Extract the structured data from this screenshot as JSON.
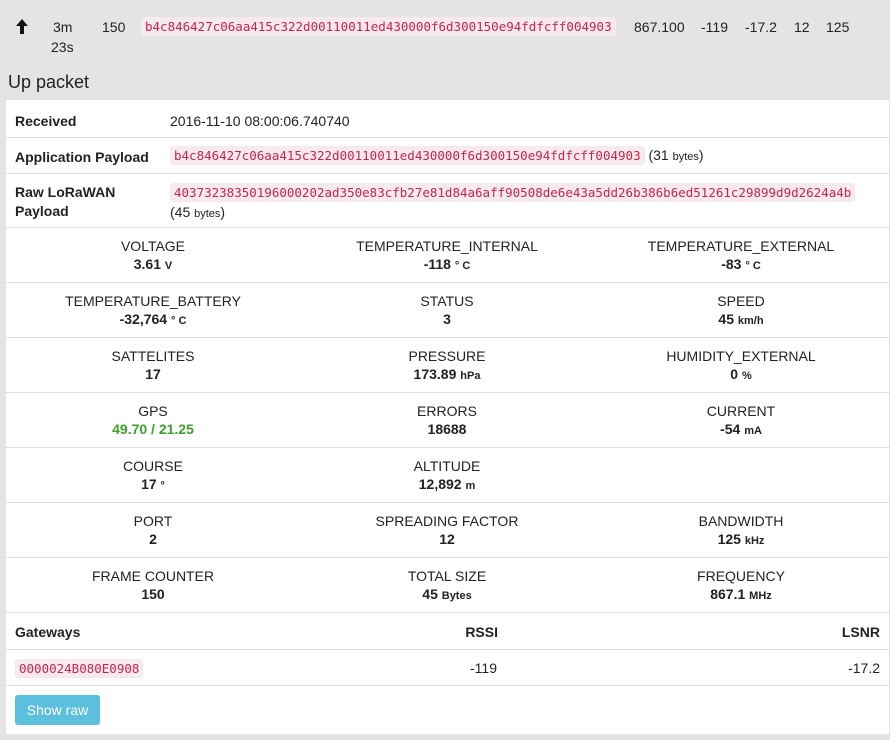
{
  "summary": {
    "time": "3m",
    "time2": "23s",
    "counter": "150",
    "payload": "b4c846427c06aa415c322d00110011ed430000f6d300150e94fdfcff004903",
    "frequency": "867.100",
    "rssi": "-119",
    "lsnr": "-17.2",
    "sf": "12",
    "bw": "125"
  },
  "section_title": "Up packet",
  "received": {
    "label": "Received",
    "value": "2016-11-10 08:00:06.740740"
  },
  "app_payload": {
    "label": "Application Payload",
    "value": "b4c846427c06aa415c322d00110011ed430000f6d300150e94fdfcff004903",
    "size_prefix": "(31 ",
    "size_unit": "bytes",
    "size_suffix": ")"
  },
  "raw_payload": {
    "label1": "Raw LoRaWAN",
    "label2": "Payload",
    "value": "40373238350196000202ad350e83cfb27e81d84a6aff90508de6e43a5dd26b386b6ed51261c29899d9d2624a4b",
    "size_prefix": "(45 ",
    "size_unit": "bytes",
    "size_suffix": ")"
  },
  "metrics": [
    [
      {
        "name": "VOLTAGE",
        "value": "3.61",
        "unit": "V"
      },
      {
        "name": "TEMPERATURE_INTERNAL",
        "value": "-118",
        "unit": "° C"
      },
      {
        "name": "TEMPERATURE_EXTERNAL",
        "value": "-83",
        "unit": "° C"
      }
    ],
    [
      {
        "name": "TEMPERATURE_BATTERY",
        "value": "-32,764",
        "unit": "° C"
      },
      {
        "name": "STATUS",
        "value": "3",
        "unit": ""
      },
      {
        "name": "SPEED",
        "value": "45",
        "unit": "km/h"
      }
    ],
    [
      {
        "name": "SATTELITES",
        "value": "17",
        "unit": ""
      },
      {
        "name": "PRESSURE",
        "value": "173.89",
        "unit": "hPa"
      },
      {
        "name": "HUMIDITY_EXTERNAL",
        "value": "0",
        "unit": "%"
      }
    ],
    [
      {
        "name": "GPS",
        "value": "49.70 / 21.25",
        "unit": ""
      },
      {
        "name": "ERRORS",
        "value": "18688",
        "unit": ""
      },
      {
        "name": "CURRENT",
        "value": "-54",
        "unit": "mA"
      }
    ],
    [
      {
        "name": "COURSE",
        "value": "17",
        "unit": "°"
      },
      {
        "name": "ALTITUDE",
        "value": "12,892",
        "unit": "m"
      }
    ],
    [
      {
        "name": "PORT",
        "value": "2",
        "unit": ""
      },
      {
        "name": "SPREADING FACTOR",
        "value": "12",
        "unit": ""
      },
      {
        "name": "BANDWIDTH",
        "value": "125",
        "unit": "kHz"
      }
    ],
    [
      {
        "name": "FRAME COUNTER",
        "value": "150",
        "unit": ""
      },
      {
        "name": "TOTAL SIZE",
        "value": "45",
        "unit": "Bytes"
      },
      {
        "name": "FREQUENCY",
        "value": "867.1",
        "unit": "MHz"
      }
    ]
  ],
  "gateways": {
    "header": "Gateways",
    "rssi_header": "RSSI",
    "lsnr_header": "LSNR",
    "rows": [
      {
        "id": "0000024B080E0908",
        "rssi": "-119",
        "lsnr": "-17.2"
      }
    ]
  },
  "show_raw_label": "Show raw",
  "colors": {
    "gps": "#3ca02a",
    "button": "#5bc0de",
    "code": "#c7254e"
  },
  "icons": {
    "summary_arrow": "arrow-up-icon"
  }
}
